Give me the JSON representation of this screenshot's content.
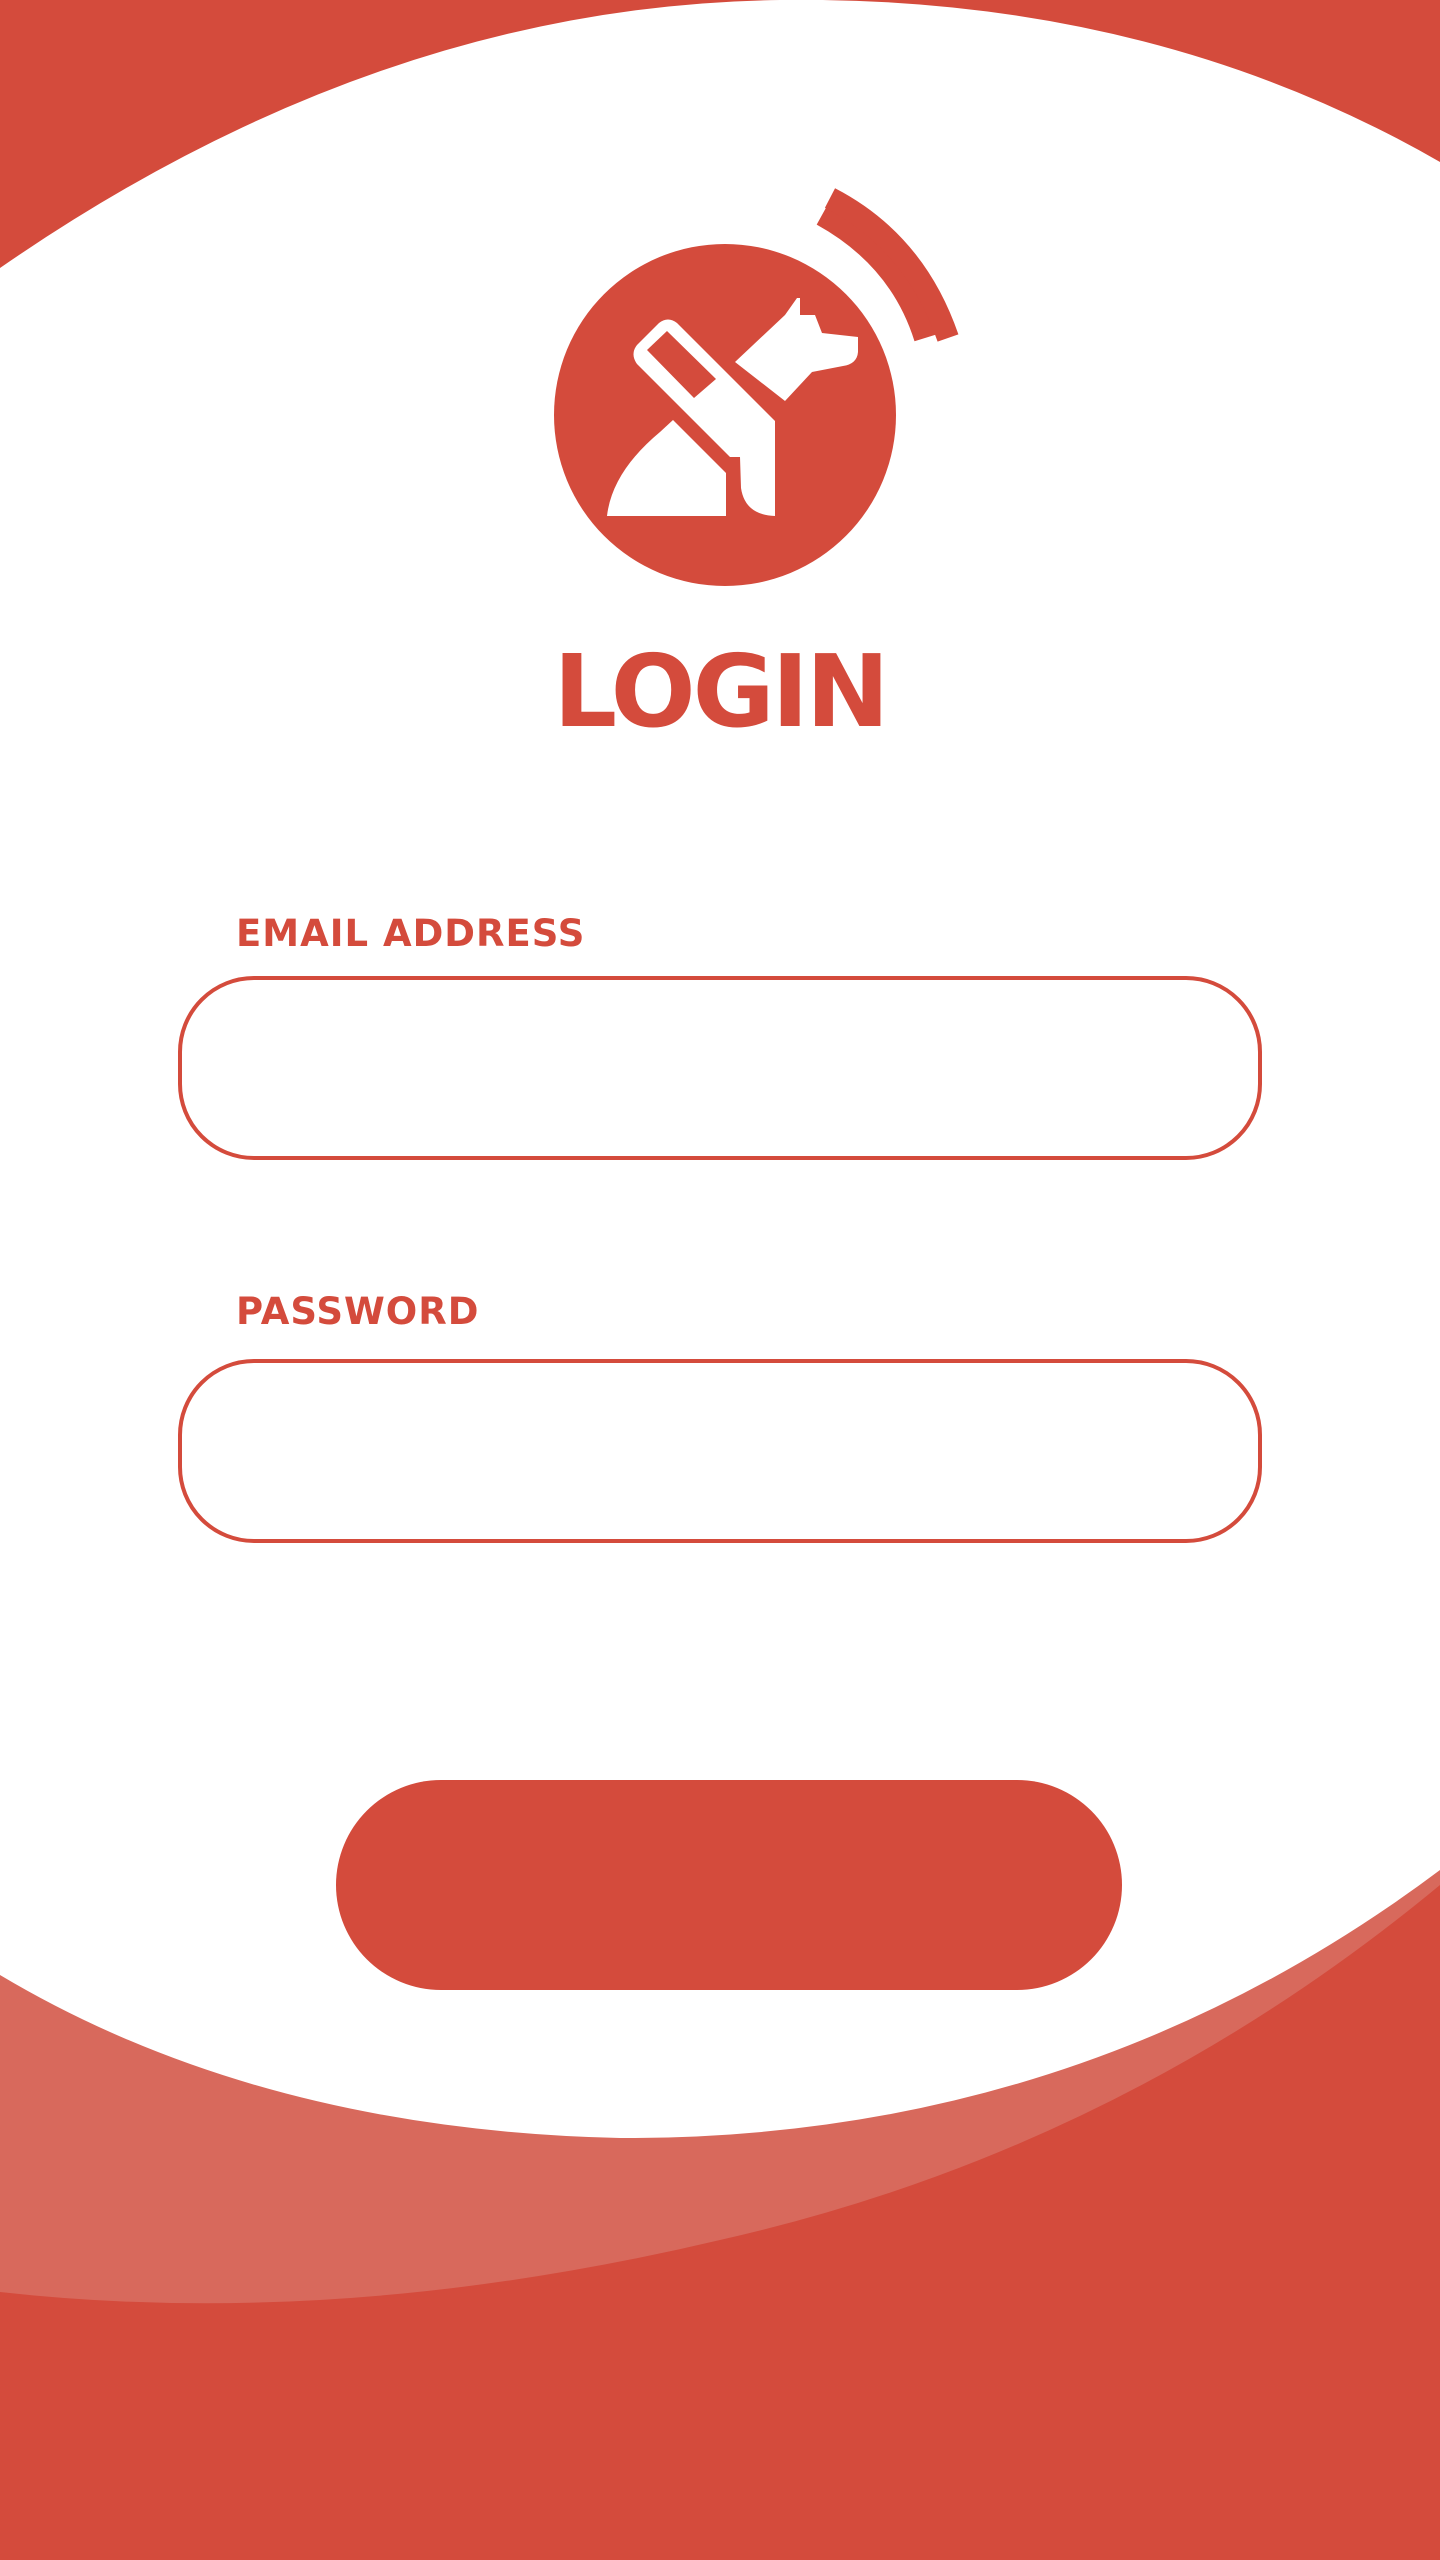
{
  "theme": {
    "accent": "#D44B3C",
    "accent_light": "#D8695C",
    "background": "#FFFFFF"
  },
  "header": {
    "logo_icon": "scanner-icon",
    "title": "LOGIN"
  },
  "form": {
    "email_label": "EMAIL ADDRESS",
    "email_value": "",
    "email_placeholder": "",
    "password_label": "PASSWORD",
    "password_value": "",
    "password_placeholder": "",
    "submit_label": ""
  }
}
